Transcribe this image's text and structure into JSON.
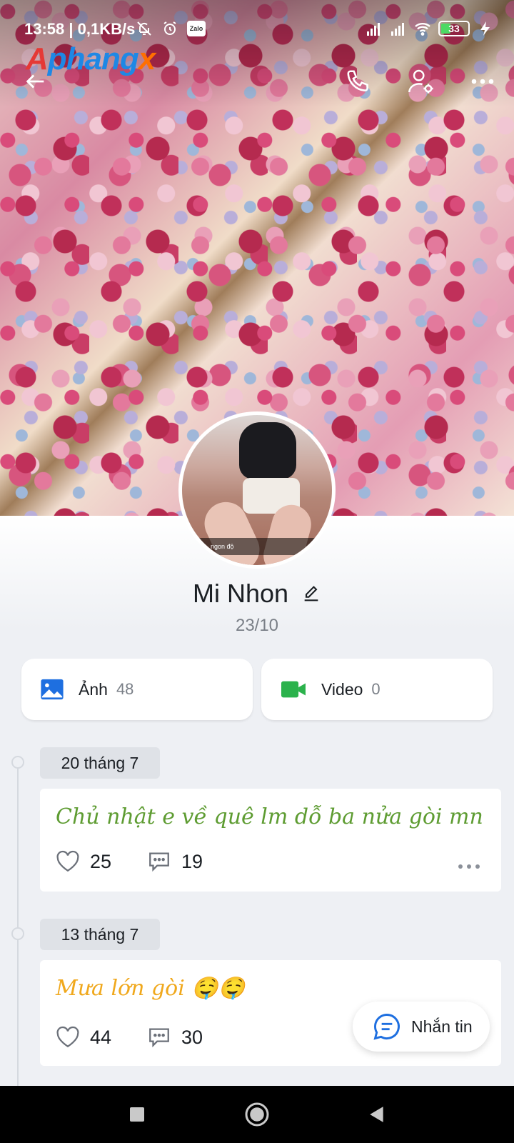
{
  "status_bar": {
    "time": "13:58",
    "network_speed": "| 0,1KB/s",
    "zalo_label": "Zalo",
    "battery": "33"
  },
  "watermark": {
    "part1": "A",
    "part2": "phang",
    "part3": "x"
  },
  "toolbar": {
    "back_icon": "arrow-left-icon",
    "call_icon": "phone-icon",
    "settings_icon": "user-gear-icon",
    "more_icon": "more-horizontal-icon"
  },
  "avatar": {
    "caption": "n, ngon độ"
  },
  "profile": {
    "name": "Mi Nhon",
    "birthday": "23/10"
  },
  "media": {
    "photos": {
      "label": "Ảnh",
      "count": "48",
      "color": "#1e6fe0"
    },
    "videos": {
      "label": "Video",
      "count": "0",
      "color": "#2bb24c"
    }
  },
  "timeline": [
    {
      "date": "20 tháng 7",
      "text": "Chủ nhật e về quê lm dỗ ba nửa gòi mn",
      "text_color": "#5e9c32",
      "likes": "25",
      "comments": "19"
    },
    {
      "date": "13 tháng 7",
      "text": "Mưa lớn gòi 🤤🤤",
      "text_color": "#f0a81c",
      "likes": "44",
      "comments": "30"
    }
  ],
  "fab": {
    "label": "Nhắn tin"
  },
  "colors": {
    "accent": "#1e6fe0",
    "background": "#eef0f4"
  }
}
